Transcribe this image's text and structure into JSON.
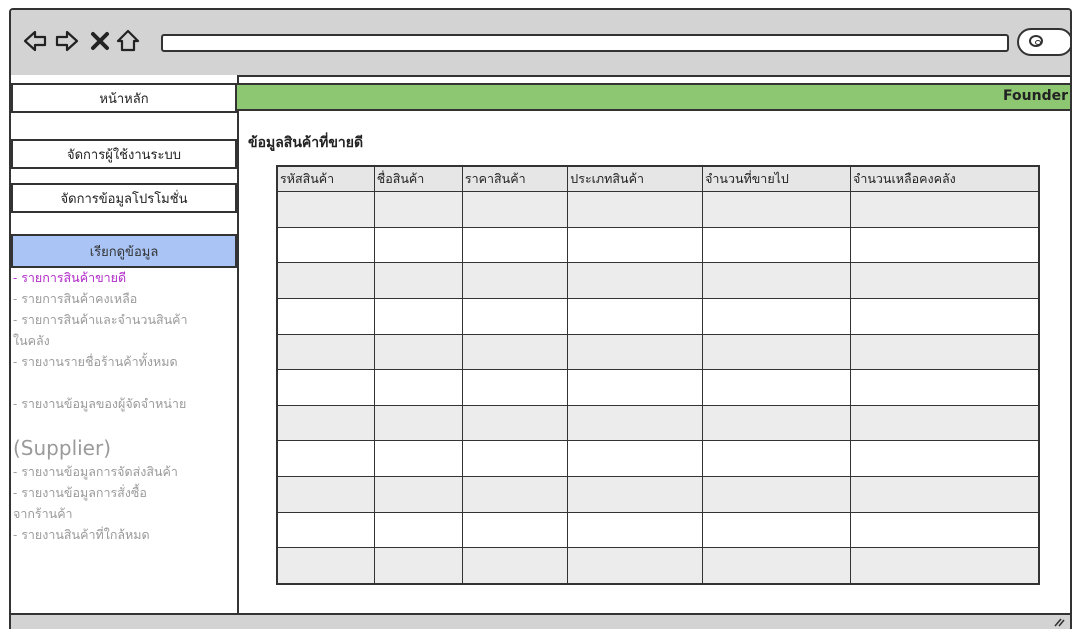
{
  "browser": {
    "back_icon": "arrow-left-icon",
    "forward_icon": "arrow-right-icon",
    "close_icon": "close-icon",
    "home_icon": "home-icon",
    "url": "",
    "search_icon": "search-icon"
  },
  "sidebar": {
    "home_label": "หน้าหลัก",
    "user_mgmt_label": "จัดการผู้ใช้งานระบบ",
    "promo_mgmt_label": "จัดการข้อมูลโปรโมชั่น",
    "view_data_label": "เรียกดูข้อมูล",
    "items": [
      {
        "label": "- รายการสินค้าขายดี"
      },
      {
        "label": "- รายการสินค้าคงเหลือ"
      },
      {
        "label": "- รายการสินค้าและจำนวนสินค้า\n  ในคลัง"
      },
      {
        "label": "- รายงานรายชื่อร้านค้าทั้งหมด"
      },
      {
        "label": "- รายงานข้อมูลของผู้จัดจำหน่าย",
        "extra": "(Supplier)"
      },
      {
        "label": "- รายงานข้อมูลการจัดส่งสินค้า"
      },
      {
        "label": "- รายงานข้อมูลการสั่งซื้อ\n  จากร้านค้า"
      },
      {
        "label": "- รายงานสินค้าที่ใกล้หมด"
      }
    ]
  },
  "header": {
    "founder_label": "Founder",
    "accent_color": "#8dc772"
  },
  "main": {
    "title": "ข้อมูลสินค้าที่ขายดี",
    "table": {
      "columns": [
        "รหัสสินค้า",
        "ชื่อสินค้า",
        "ราคาสินค้า",
        "ประเภทสินค้า",
        "จำนวนที่ขายไป",
        "จำนวนเหลือคงคลัง"
      ],
      "row_count": 11
    }
  }
}
